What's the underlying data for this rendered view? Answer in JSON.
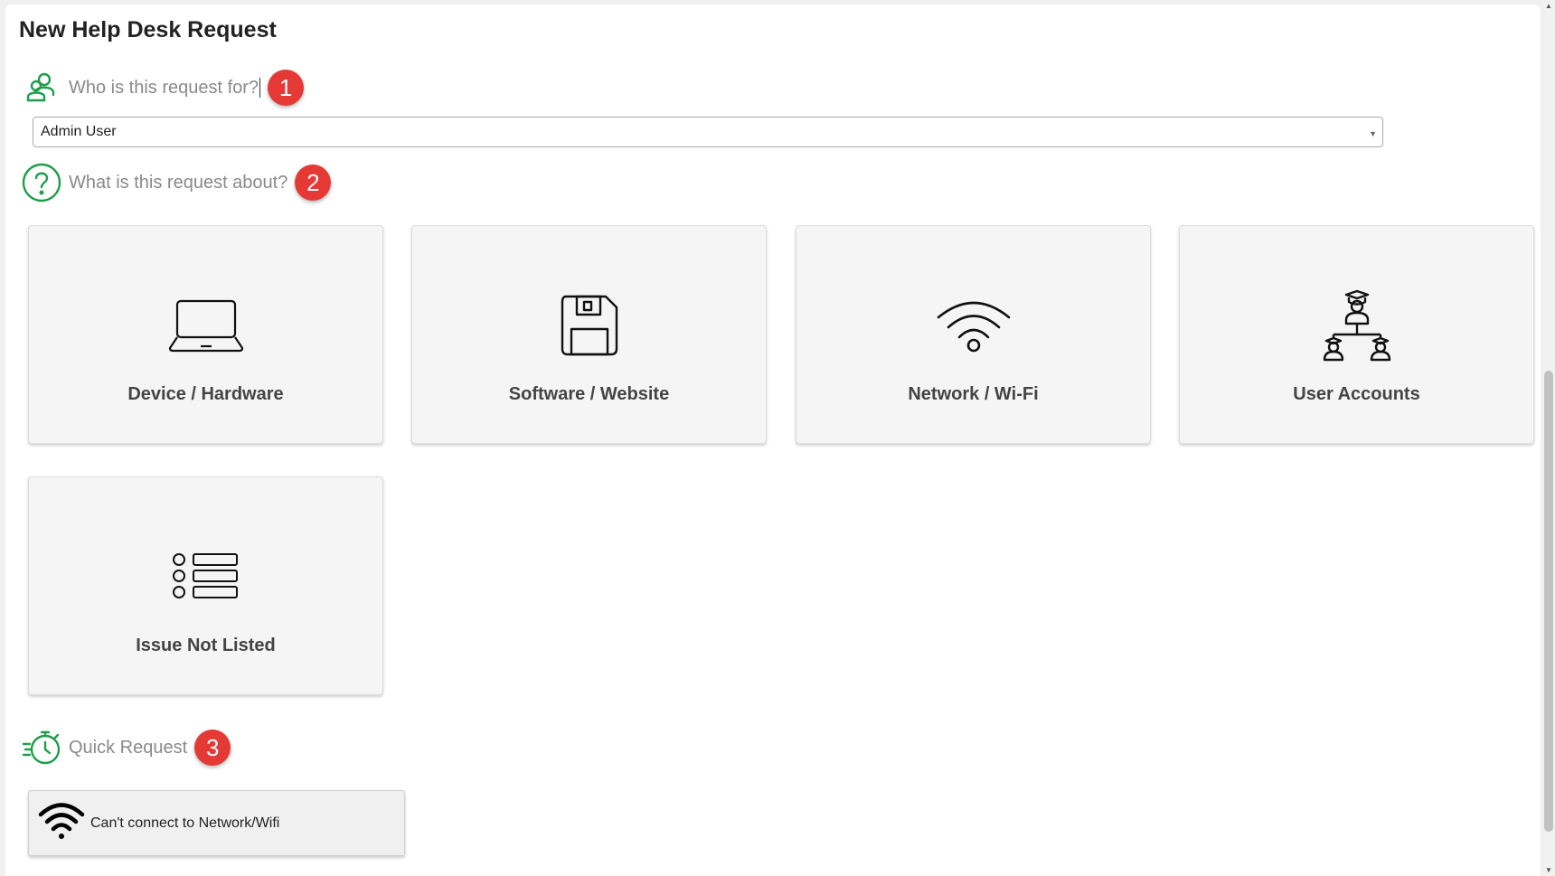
{
  "page": {
    "title": "New Help Desk Request"
  },
  "requester": {
    "label": "Who is this request for?",
    "badge": "1",
    "icon": "user-group-icon",
    "selected": "Admin User"
  },
  "topic": {
    "label": "What is this request about?",
    "badge": "2",
    "icon": "question-circle-icon",
    "options": [
      {
        "label": "Device / Hardware",
        "icon": "laptop-icon"
      },
      {
        "label": "Software / Website",
        "icon": "floppy-disk-icon"
      },
      {
        "label": "Network / Wi-Fi",
        "icon": "wifi-icon"
      },
      {
        "label": "User Accounts",
        "icon": "user-hierarchy-icon"
      },
      {
        "label": "Issue Not Listed",
        "icon": "list-icon"
      }
    ]
  },
  "quick": {
    "label": "Quick Request",
    "badge": "3",
    "icon": "stopwatch-icon",
    "items": [
      {
        "label": "Can't connect to Network/Wifi",
        "icon": "wifi-icon"
      }
    ]
  },
  "colors": {
    "accent": "#1e9e4a",
    "badge": "#e53935",
    "tile_bg": "#f5f5f5"
  }
}
